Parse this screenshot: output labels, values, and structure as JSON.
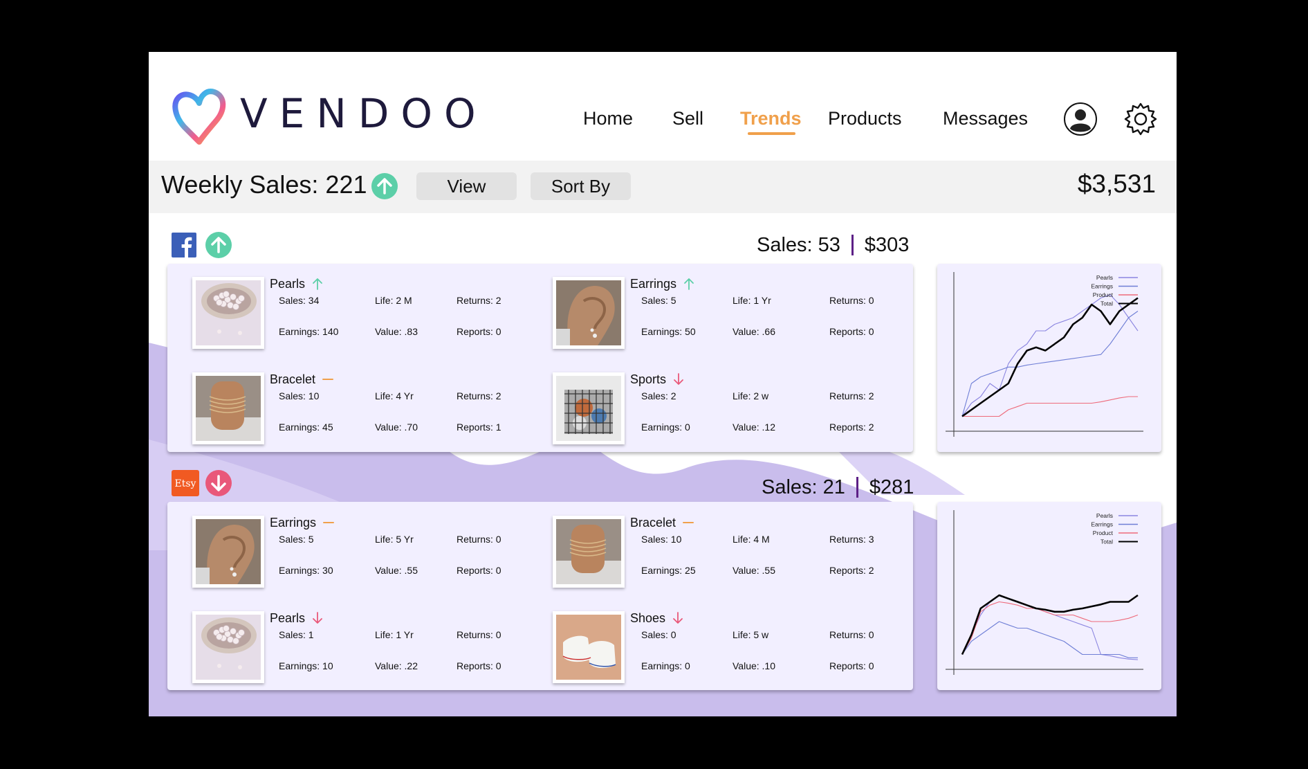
{
  "app": {
    "brand": "VENDOO"
  },
  "nav": {
    "items": [
      "Home",
      "Sell",
      "Trends",
      "Products",
      "Messages"
    ],
    "active": "Trends",
    "active_color": "#f0a04b"
  },
  "header_icons": {
    "account": "account-circle-icon",
    "settings": "gear-icon"
  },
  "toolbar": {
    "weekly_sales": "Weekly Sales: 221",
    "weekly_trend": "up",
    "view_label": "View",
    "sort_label": "Sort By",
    "total": "$3,531"
  },
  "colors": {
    "up": "#5ccfa8",
    "down": "#e9587a",
    "flat": "#f0a04b",
    "card": "#f2efff",
    "blob": "#c9bdec",
    "divider": "#5c1f86"
  },
  "sections": [
    {
      "platform": "facebook",
      "platform_icon": "facebook-icon",
      "trend": "up",
      "sales": "Sales: 53",
      "amount": "$303",
      "items": [
        {
          "name": "Pearls",
          "trend": "up",
          "image": "pearls",
          "sales": "Sales: 34",
          "life": "Life: 2 M",
          "returns": "Returns: 2",
          "earnings": "Earnings: 140",
          "value": "Value: .83",
          "reports": "Reports: 0"
        },
        {
          "name": "Earrings",
          "trend": "up",
          "image": "earrings",
          "sales": "Sales: 5",
          "life": "Life: 1 Yr",
          "returns": "Returns: 0",
          "earnings": "Earnings: 50",
          "value": "Value: .66",
          "reports": "Reports:  0"
        },
        {
          "name": "Bracelet",
          "trend": "flat",
          "image": "bracelet",
          "sales": "Sales: 10",
          "life": "Life: 4 Yr",
          "returns": "Returns: 2",
          "earnings": "Earnings:  45",
          "value": "Value: .70",
          "reports": "Reports: 1"
        },
        {
          "name": "Sports",
          "trend": "down",
          "image": "sports",
          "sales": "Sales: 2",
          "life": "Life: 2 w",
          "returns": "Returns: 2",
          "earnings": "Earnings: 0",
          "value": "Value: .12",
          "reports": "Reports: 2"
        }
      ],
      "chart_data": {
        "type": "line",
        "x": [
          0,
          1,
          2,
          3,
          4,
          5,
          6,
          7,
          8,
          9,
          10,
          11,
          12,
          13,
          14,
          15,
          16,
          17,
          18,
          19
        ],
        "ylim": [
          0,
          20
        ],
        "legend": "top-right",
        "series": [
          {
            "name": "Pearls",
            "color": "#8b85e0",
            "values": [
              1,
              3,
              4,
              6,
              5,
              9,
              11,
              12,
              14,
              14,
              15,
              15.5,
              16,
              17,
              18,
              19,
              19.5,
              18,
              16,
              14
            ]
          },
          {
            "name": "Earrings",
            "color": "#6f7fd6",
            "values": [
              1,
              6,
              7,
              7.5,
              8,
              8.5,
              8.5,
              8.8,
              9,
              9.2,
              9.4,
              9.6,
              9.8,
              10,
              10.2,
              10.4,
              12,
              14,
              16,
              17
            ]
          },
          {
            "name": "Product",
            "color": "#ee6a7a",
            "values": [
              1,
              1,
              1,
              1,
              1,
              2,
              2.5,
              3,
              3,
              3,
              3,
              3,
              3,
              3,
              3,
              3.2,
              3.5,
              3.8,
              4,
              4
            ]
          },
          {
            "name": "Total",
            "color": "#000000",
            "values": [
              1,
              2,
              3,
              4,
              5,
              6,
              9,
              11,
              11.5,
              11,
              12,
              13,
              15,
              16,
              18,
              17,
              15,
              17,
              18,
              19
            ]
          }
        ]
      }
    },
    {
      "platform": "etsy",
      "platform_icon": "etsy-icon",
      "platform_label": "Etsy",
      "trend": "down",
      "sales": "Sales: 21",
      "amount": "$281",
      "items": [
        {
          "name": "Earrings",
          "trend": "flat",
          "image": "earrings",
          "sales": "Sales: 5",
          "life": "Life: 5 Yr",
          "returns": "Returns: 0",
          "earnings": "Earnings: 30",
          "value": "Value: .55",
          "reports": "Reports: 0"
        },
        {
          "name": "Bracelet",
          "trend": "flat",
          "image": "bracelet",
          "sales": "Sales: 10",
          "life": "Life: 4 M",
          "returns": "Returns: 3",
          "earnings": "Earnings: 25",
          "value": "Value: .55",
          "reports": "Reports: 2"
        },
        {
          "name": "Pearls",
          "trend": "down",
          "image": "pearls",
          "sales": "Sales: 1",
          "life": "Life: 1 Yr",
          "returns": "Returns: 0",
          "earnings": "Earnings: 10",
          "value": "Value: .22",
          "reports": "Reports: 0"
        },
        {
          "name": "Shoes",
          "trend": "down",
          "image": "shoes",
          "sales": "Sales: 0",
          "life": "Life: 5 w",
          "returns": "Returns: 0",
          "earnings": "Earnings: 0",
          "value": "Value: .10",
          "reports": "Reports: 0"
        }
      ],
      "chart_data": {
        "type": "line",
        "x": [
          0,
          1,
          2,
          3,
          4,
          5,
          6,
          7,
          8,
          9,
          10,
          11,
          12,
          13,
          14,
          15,
          16,
          17,
          18,
          19
        ],
        "ylim": [
          0,
          20
        ],
        "legend": "top-right",
        "series": [
          {
            "name": "Pearls",
            "color": "#8b85e0",
            "values": [
              1,
              4,
              7,
              9,
              10,
              9.5,
              9,
              8.5,
              8,
              7.5,
              7,
              6.5,
              6,
              5.5,
              5,
              1,
              0.8,
              0.5,
              0.3,
              0.2
            ]
          },
          {
            "name": "Earrings",
            "color": "#6f7fd6",
            "values": [
              1,
              3,
              4,
              5,
              6,
              5.5,
              5,
              5,
              4.5,
              4,
              3.5,
              3,
              2,
              1,
              1,
              1,
              1,
              1,
              0.5,
              0.5
            ]
          },
          {
            "name": "Product",
            "color": "#ee6a7a",
            "values": [
              1,
              3.5,
              7.5,
              8.5,
              9,
              8.8,
              8.5,
              8,
              8,
              7.5,
              7,
              7,
              7,
              6.5,
              6,
              6,
              6,
              6.2,
              6.5,
              7
            ]
          },
          {
            "name": "Total",
            "color": "#000000",
            "values": [
              1,
              4,
              8,
              9,
              10,
              9.5,
              9,
              8.5,
              8,
              7.8,
              7.5,
              7.5,
              7.8,
              8,
              8.3,
              8.6,
              9,
              9,
              9,
              10
            ]
          }
        ]
      }
    }
  ]
}
